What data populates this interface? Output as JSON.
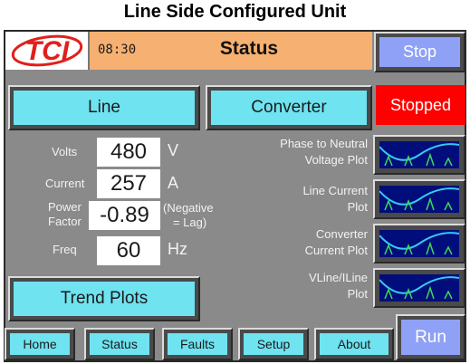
{
  "page_title": "Line Side Configured Unit",
  "header": {
    "logo_text": "TCI",
    "time": "08:30",
    "title": "Status",
    "stop_label": "Stop"
  },
  "tabs": {
    "line_label": "Line",
    "converter_label": "Converter"
  },
  "status_indicator": {
    "label": "Stopped",
    "color": "#ff0000"
  },
  "readings": {
    "volts": {
      "label": "Volts",
      "value": "480",
      "unit": "V"
    },
    "current": {
      "label": "Current",
      "value": "257",
      "unit": "A"
    },
    "power_factor": {
      "label_line1": "Power",
      "label_line2": "Factor",
      "value": "-0.89",
      "note_line1": "(Negative",
      "note_line2": "= Lag)"
    },
    "freq": {
      "label": "Freq",
      "value": "60",
      "unit": "Hz"
    }
  },
  "trend_plots_label": "Trend Plots",
  "plots": [
    {
      "line1": "Phase to Neutral",
      "line2": "Voltage Plot",
      "icon": "waveform-thumbnail-icon"
    },
    {
      "line1": "Line Current",
      "line2": "Plot",
      "icon": "waveform-thumbnail-icon"
    },
    {
      "line1": "Converter",
      "line2": "Current Plot",
      "icon": "waveform-thumbnail-icon"
    },
    {
      "line1": "VLine/ILine",
      "line2": "Plot",
      "icon": "waveform-thumbnail-icon"
    }
  ],
  "nav": {
    "home": "Home",
    "status": "Status",
    "faults": "Faults",
    "setup": "Setup",
    "about": "About"
  },
  "run_label": "Run",
  "colors": {
    "header_bg": "#f6b071",
    "button_cyan": "#6fe3f0",
    "button_purple": "#8fa1f6",
    "panel_gray": "#8a8a8a",
    "logo_red": "#e0201c"
  }
}
